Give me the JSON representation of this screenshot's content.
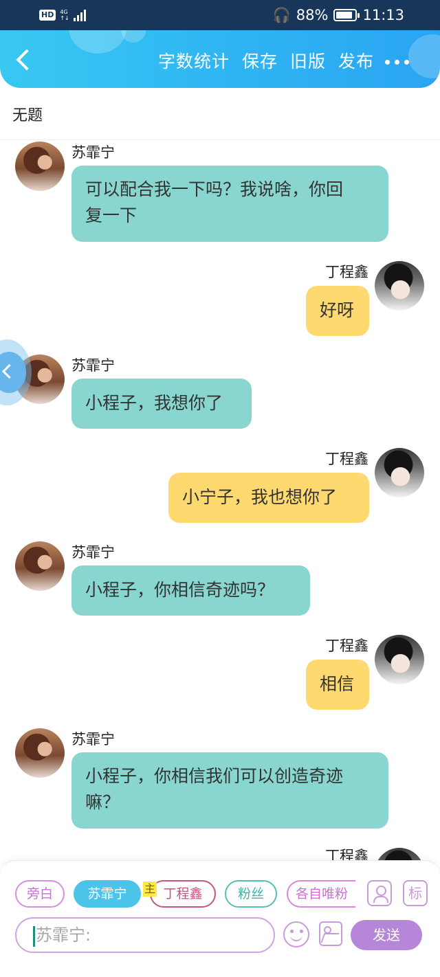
{
  "status_bar": {
    "hd": "HD",
    "network": "4G",
    "battery": "88%",
    "battery_level": 0.88,
    "time": "11:13"
  },
  "header": {
    "actions": [
      "字数统计",
      "保存",
      "旧版",
      "发布"
    ]
  },
  "document": {
    "title": "无题"
  },
  "messages": [
    {
      "sender": "苏霏宁",
      "side": "left",
      "text_lines": [
        "可以配合我一下吗？我说啥，你回",
        "复一下"
      ]
    },
    {
      "sender": "丁程鑫",
      "side": "right",
      "text_lines": [
        "好呀"
      ]
    },
    {
      "sender": "苏霏宁",
      "side": "left",
      "text_lines": [
        "小程子，我想你了"
      ]
    },
    {
      "sender": "丁程鑫",
      "side": "right",
      "text_lines": [
        "小宁子，我也想你了"
      ]
    },
    {
      "sender": "苏霏宁",
      "side": "left",
      "text_lines": [
        "小程子，你相信奇迹吗？"
      ]
    },
    {
      "sender": "丁程鑫",
      "side": "right",
      "text_lines": [
        "相信"
      ]
    },
    {
      "sender": "苏霏宁",
      "side": "left",
      "text_lines": [
        "小程子，你相信我们可以创造奇迹",
        "嘛？"
      ]
    },
    {
      "sender": "丁程鑫",
      "side": "right",
      "text_lines": []
    }
  ],
  "composer": {
    "roles": [
      "旁白",
      "苏霏宁",
      "丁程鑫",
      "粉丝",
      "各自唯粉"
    ],
    "main_tag": "主",
    "mark_label": "标",
    "input_placeholder": "苏霏宁:",
    "send_label": "发送"
  },
  "colors": {
    "header": "#2fb4f3",
    "left_bubble": "#88d6cf",
    "right_bubble": "#fdd970",
    "accent": "#b687d9"
  }
}
